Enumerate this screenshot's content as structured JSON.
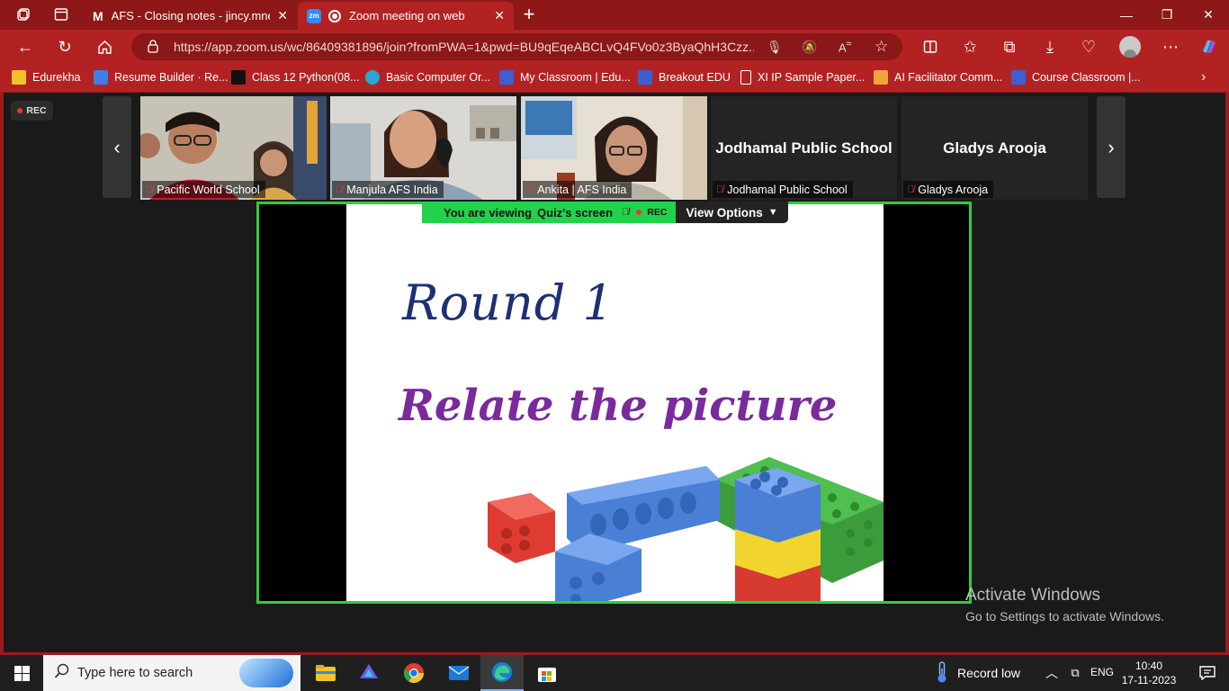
{
  "browser": {
    "tabs": [
      {
        "label": "AFS - Closing notes - jincy.mnels",
        "icon": "gmail-icon"
      },
      {
        "label": "Zoom meeting on web",
        "icon": "zoom-icon"
      }
    ],
    "url": "https://app.zoom.us/wc/86409381896/join?fromPWA=1&pwd=BU9qEqeABCLvQ4FVo0z3ByaQhH3Czz....",
    "bookmarks": [
      {
        "label": "Edurekha",
        "color": "#f4c22b"
      },
      {
        "label": "Resume Builder · Re...",
        "color": "#3f7ee8"
      },
      {
        "label": "Class 12 Python(08...",
        "color": "#111111"
      },
      {
        "label": "Basic Computer Or...",
        "color": "#2aa6d6"
      },
      {
        "label": "My Classroom | Edu...",
        "color": "#3d5fcf"
      },
      {
        "label": "Breakout EDU",
        "color": "#3a5fd0"
      },
      {
        "label": "XI IP Sample Paper...",
        "color": "#ffffff"
      },
      {
        "label": "AI Facilitator Comm...",
        "color": "#f2a33a"
      },
      {
        "label": "Course Classroom |...",
        "color": "#3d5fcf"
      }
    ]
  },
  "meeting": {
    "rec_label": "REC",
    "participants": [
      {
        "name": "Pacific World School",
        "video": true
      },
      {
        "name": "Manjula AFS India",
        "video": true
      },
      {
        "name": "Ankita | AFS India",
        "video": true
      },
      {
        "name": "Jodhamal Public School",
        "video": false,
        "badge": "Jodhamal Public School"
      },
      {
        "name": "Gladys Arooja",
        "video": false,
        "badge": "Gladys Arooja"
      }
    ],
    "viewing_prefix": "You are viewing",
    "viewing_name": "Quiz's screen",
    "viewing_rec": "REC",
    "view_options": "View Options",
    "slide": {
      "title": "Round 1",
      "subtitle": "Relate the picture"
    }
  },
  "watermark": {
    "line1": "Activate Windows",
    "line2": "Go to Settings to activate Windows."
  },
  "taskbar": {
    "search_placeholder": "Type here to search",
    "weather": "Record low",
    "language": "ENG",
    "time": "10:40",
    "date": "17-11-2023"
  }
}
